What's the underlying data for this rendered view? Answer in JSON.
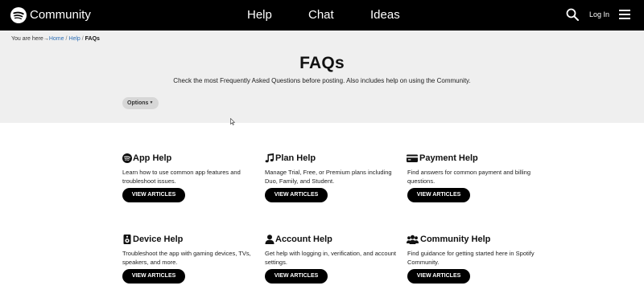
{
  "header": {
    "brand": "Community",
    "nav": [
      "Help",
      "Chat",
      "Ideas"
    ],
    "login": "Log In",
    "icons": [
      "spotify-logo-icon",
      "search-icon",
      "hamburger-menu-icon"
    ]
  },
  "breadcrumb": {
    "prefix": "You are here",
    "items": [
      "Home",
      "Help",
      "FAQs"
    ]
  },
  "hero": {
    "title": "FAQs",
    "subtitle": "Check the most Frequently Asked Questions before posting. Also includes help on using the Community.",
    "options_label": "Options"
  },
  "cards": [
    {
      "icon": "spotify-icon",
      "title": "App Help",
      "desc": "Learn how to use common app features and troubleshoot issues.",
      "button": "VIEW ARTICLES"
    },
    {
      "icon": "music-note-icon",
      "title": "Plan Help",
      "desc": "Manage Trial, Free, or Premium plans including Duo, Family, and Student.",
      "button": "VIEW ARTICLES"
    },
    {
      "icon": "credit-card-icon",
      "title": "Payment Help",
      "desc": "Find answers for common payment and billing questions.",
      "button": "VIEW ARTICLES"
    },
    {
      "icon": "speaker-icon",
      "title": "Device Help",
      "desc": "Troubleshoot the app with gaming devices, TVs, speakers, and more.",
      "button": "VIEW ARTICLES"
    },
    {
      "icon": "user-icon",
      "title": "Account Help",
      "desc": "Get help with logging in, verification, and account settings.",
      "button": "VIEW ARTICLES"
    },
    {
      "icon": "users-icon",
      "title": "Community Help",
      "desc": "Find guidance for getting started here in Spotify Community.",
      "button": "VIEW ARTICLES"
    }
  ],
  "colors": {
    "header_bg": "#000000",
    "hero_bg": "#efefef",
    "link": "#2e6fb5",
    "button_bg": "#000000"
  }
}
